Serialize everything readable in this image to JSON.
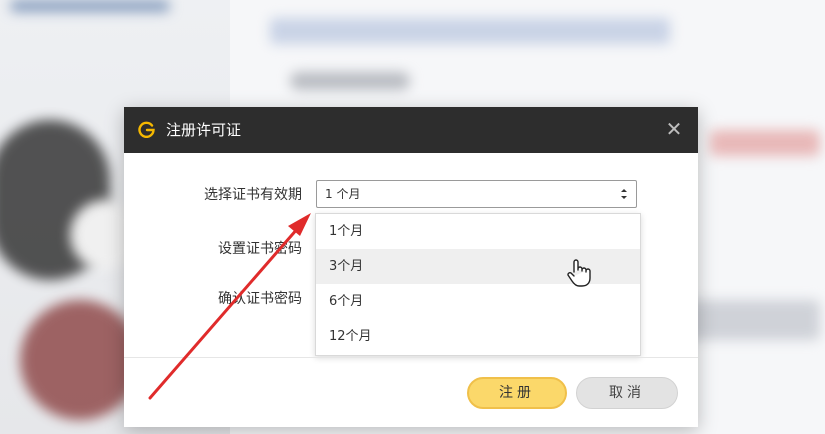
{
  "dialog": {
    "title": "注册许可证",
    "close_icon": "close-icon",
    "logo_icon": "app-logo-icon",
    "fields": {
      "validity_label": "选择证书有效期",
      "password_label": "设置证书密码",
      "confirm_label": "确认证书密码"
    },
    "select": {
      "value": "1 个月",
      "options": [
        "1个月",
        "3个月",
        "6个月",
        "12个月"
      ],
      "hovered_option": "3个月"
    },
    "buttons": {
      "register": "注册",
      "cancel": "取消"
    }
  },
  "colors": {
    "titlebar": "#2d2d2d",
    "primary_button": "#fbd86a",
    "annotation_arrow": "#e02b2b"
  },
  "overlay": {
    "cursor_icon": "hand-pointer-icon",
    "annotation": "red-arrow-icon"
  }
}
